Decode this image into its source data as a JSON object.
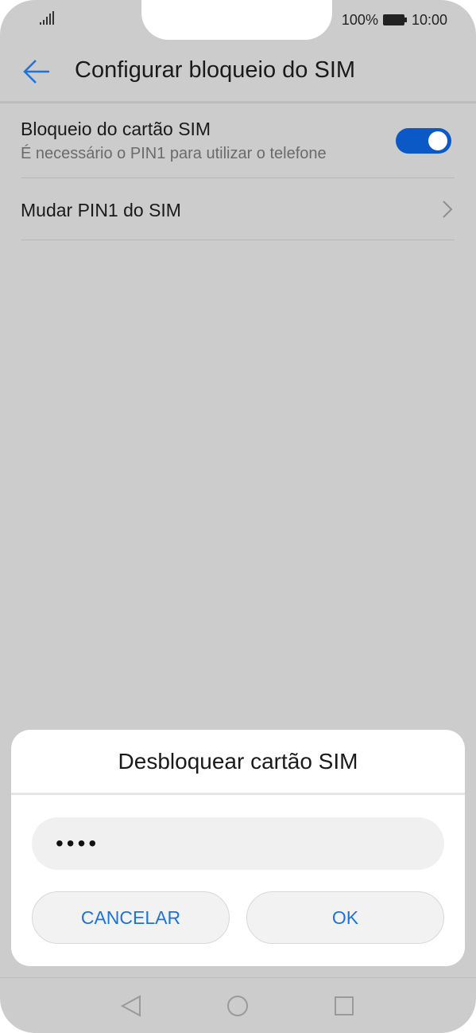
{
  "status_bar": {
    "battery_percent": "100%",
    "time": "10:00"
  },
  "header": {
    "title": "Configurar bloqueio do SIM",
    "back_icon": "arrow-left-icon"
  },
  "settings": {
    "sim_lock": {
      "title": "Bloqueio do cartão SIM",
      "subtitle": "É necessário o PIN1 para utilizar o telefone",
      "enabled": true
    },
    "change_pin": {
      "title": "Mudar PIN1 do SIM"
    }
  },
  "dialog": {
    "title": "Desbloquear cartão SIM",
    "pin_value": "••••",
    "cancel_label": "CANCELAR",
    "ok_label": "OK"
  },
  "nav_bar": {
    "icons": [
      "triangle-back-icon",
      "circle-home-icon",
      "square-recent-icon"
    ]
  },
  "colors": {
    "accent": "#0a59c7",
    "button_text": "#1e73d8",
    "dim_background": "#cccccc"
  }
}
